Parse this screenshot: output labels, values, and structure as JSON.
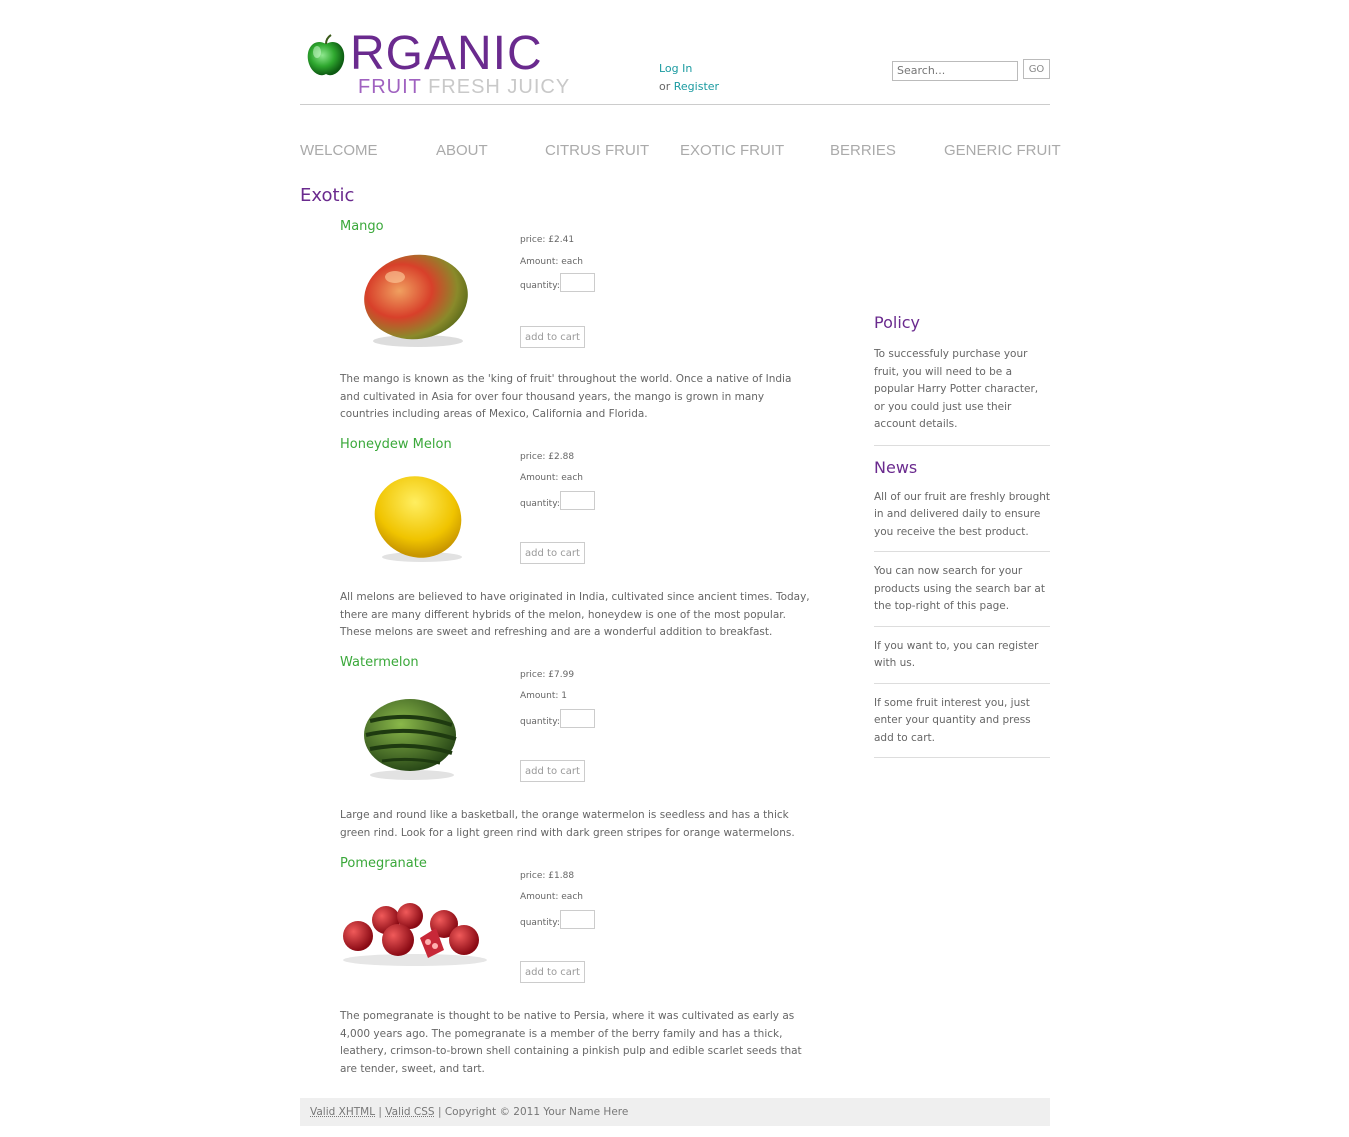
{
  "header": {
    "logo_main": "RGANIC",
    "logo_sub_1": "FRUIT",
    "logo_sub_2": "FRESH JUICY",
    "login_label": "Log In",
    "or_text": "or",
    "register_label": "Register",
    "search_placeholder": "Search...",
    "go_label": "GO"
  },
  "nav": [
    "WELCOME",
    "ABOUT",
    "CITRUS FRUIT",
    "EXOTIC FRUIT",
    "BERRIES",
    "GENERIC FRUIT"
  ],
  "section_title": "Exotic",
  "labels": {
    "quantity": "quantity:",
    "add_to_cart": "add to cart"
  },
  "products": [
    {
      "name": "Mango",
      "price": "price: £2.41",
      "amount": "Amount: each",
      "description": "The mango is known as the 'king of fruit' throughout the world. Once a native of India and cultivated in Asia for over four thousand years, the mango is grown in many countries including areas of Mexico, California and Florida."
    },
    {
      "name": "Honeydew Melon",
      "price": "price: £2.88",
      "amount": "Amount: each",
      "description": "All melons are believed to have originated in India, cultivated since ancient times. Today, there are many different hybrids of the melon, honeydew is one of the most popular. These melons are sweet and refreshing and are a wonderful addition to breakfast."
    },
    {
      "name": "Watermelon",
      "price": "price: £7.99",
      "amount": "Amount: 1",
      "description": "Large and round like a basketball, the orange watermelon is seedless and has a thick green rind. Look for a light green rind with dark green stripes for orange watermelons."
    },
    {
      "name": "Pomegranate",
      "price": "price: £1.88",
      "amount": "Amount: each",
      "description": "The pomegranate is thought to be native to Persia, where it was cultivated as early as 4,000 years ago. The pomegranate is a member of the berry family and has a thick, leathery, crimson-to-brown shell containing a pinkish pulp and edible scarlet seeds that are tender, sweet, and tart."
    }
  ],
  "sidebar": {
    "policy_title": "Policy",
    "policy_text": "To successfuly purchase your fruit, you will need to be a popular Harry Potter character, or you could just use their account details.",
    "news_title": "News",
    "news_items": [
      "All of our fruit are freshly brought in and delivered daily to ensure you receive the best product.",
      "You can now search for your products using the search bar at the top-right of this page.",
      "If you want to, you can register with us.",
      "If some fruit interest you, just enter your quantity and press add to cart."
    ]
  },
  "footer": {
    "valid_xhtml": "Valid XHTML",
    "sep": "|",
    "valid_css": "Valid CSS",
    "copyright": "| Copyright © 2011 Your Name Here"
  },
  "colors": {
    "brand_purple": "#6a2a8e",
    "product_green": "#3aa83a",
    "link_teal": "#1a9aa0"
  }
}
